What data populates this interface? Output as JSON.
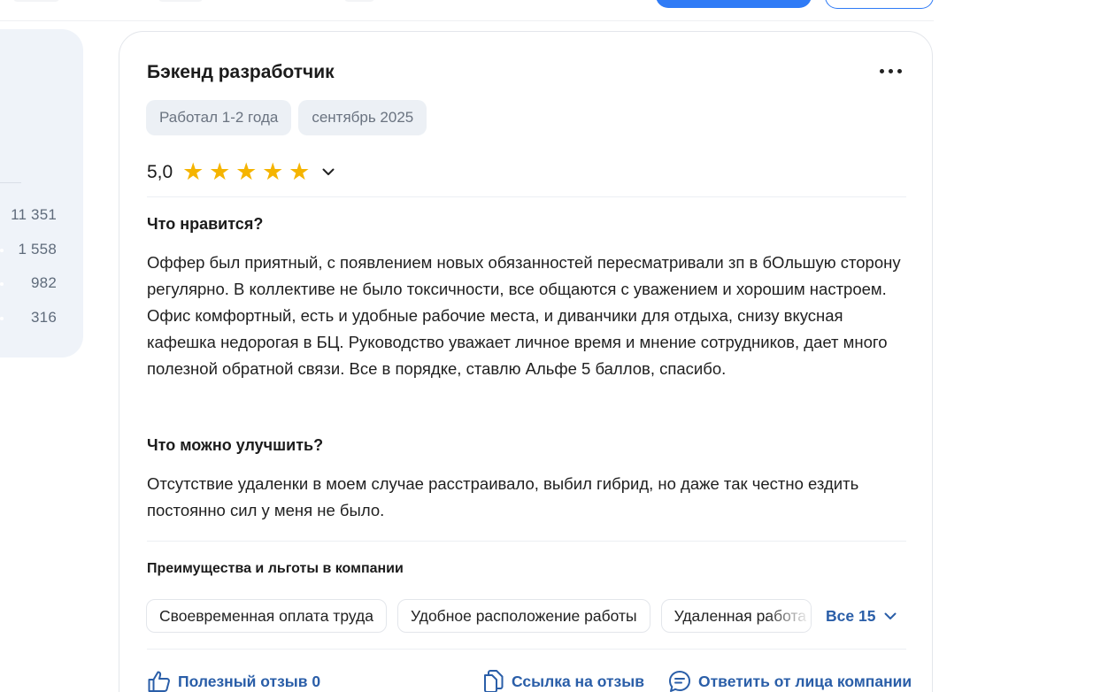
{
  "left_stats": [
    "11 351",
    "1 558",
    "982",
    "316"
  ],
  "review": {
    "title": "Бэкенд разработчик",
    "tags": [
      "Работал 1-2 года",
      "сентябрь 2025"
    ],
    "rating": "5,0",
    "rating_stars": 5,
    "likes_heading": "Что нравится?",
    "likes_text": "Оффер был приятный, с появлением новых обязанностей пересматривали зп в бОльшую сторону регулярно. В коллективе не было токсичности, все общаются с уважением и хорошим настроем. Офис комфортный, есть и удобные рабочие места, и диванчики для отдыха, снизу вкусная кафешка недорогая в БЦ. Руководство уважает личное время и мнение сотрудников, дает много полезной обратной связи. Все в порядке, ставлю Альфе 5 баллов, спасибо.",
    "improve_heading": "Что можно улучшить?",
    "improve_text": "Отсутствие удаленки в моем случае расстраивало, выбил гибрид, но даже так честно ездить постоянно сил у меня не было.",
    "benefits_title": "Преимущества и льготы в компании",
    "benefits": [
      "Своевременная оплата труда",
      "Удобное расположение работы",
      "Удаленная работа"
    ],
    "benefits_all": "Все 15",
    "actions": {
      "helpful": "Полезный отзыв 0",
      "link": "Ссылка на отзыв",
      "reply": "Ответить от лица компании"
    }
  },
  "colors": {
    "accent": "#2a5ea8",
    "primary_button": "#2f7bf6",
    "star": "#f5b400",
    "tag_bg": "#ecf0f5",
    "panel_bg": "#eff3f9"
  },
  "icons": {
    "more": "more-horizontal-icon",
    "rating_toggle": "chevron-down-icon",
    "benefits_toggle": "chevron-down-icon",
    "helpful": "thumbs-up-icon",
    "link": "copy-link-icon",
    "reply": "chat-bubble-icon"
  }
}
